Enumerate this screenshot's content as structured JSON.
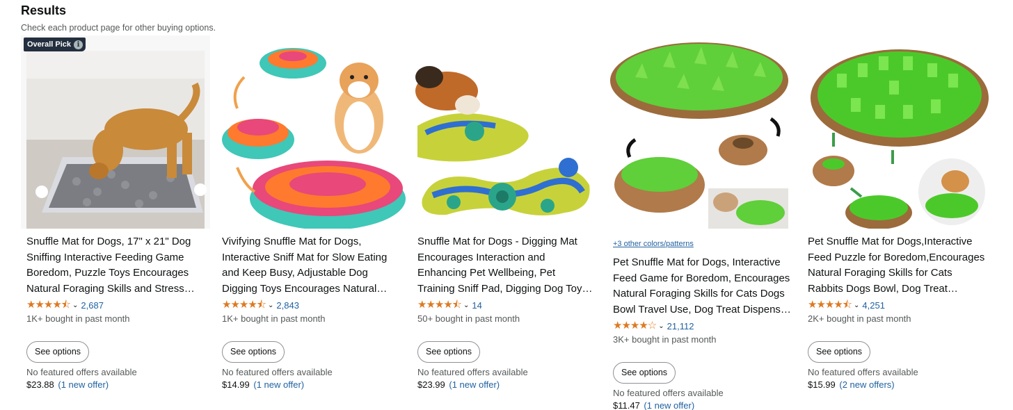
{
  "header": {
    "title": "Results",
    "subtitle": "Check each product page for other buying options."
  },
  "colors": {
    "star": "#de7921",
    "link": "#2162a1",
    "badge_bg": "#232f3e"
  },
  "products": [
    {
      "badge": "Overall Pick",
      "badge_icon": "info-icon",
      "title_lines": [
        "Snuffle Mat for Dogs, 17\" x 21\" Dog",
        "Sniffing Interactive Feeding Game",
        "Boredom, Puzzle Toys Encourages",
        "Natural Foraging Skills and Stress…"
      ],
      "stars": "★★★★⯪",
      "rating": 4.5,
      "rating_count": "2,687",
      "bought": "1K+ bought in past month",
      "button": "See options",
      "no_offer": "No featured offers available",
      "price": "$23.88",
      "offer": "(1 new offer)"
    },
    {
      "title_lines": [
        "Vivifying Snuffle Mat for Dogs,",
        "Interactive Sniff Mat for Slow Eating",
        "and Keep Busy, Adjustable Dog",
        "Digging Toys Encourages Natural…"
      ],
      "stars": "★★★★⯪",
      "rating": 4.5,
      "rating_count": "2,843",
      "bought": "1K+ bought in past month",
      "button": "See options",
      "no_offer": "No featured offers available",
      "price": "$14.99",
      "offer": "(1 new offer)"
    },
    {
      "title_lines": [
        "Snuffle Mat for Dogs - Digging Mat",
        "Encourages Interaction and",
        "Enhancing Pet Wellbeing, Pet",
        "Training Sniff Pad, Digging Dog Toy…"
      ],
      "stars": "★★★★⯪",
      "rating": 4.5,
      "rating_count": "14",
      "bought": "50+ bought in past month",
      "button": "See options",
      "no_offer": "No featured offers available",
      "price": "$23.99",
      "offer": "(1 new offer)"
    },
    {
      "colors_link": "+3 other colors/patterns",
      "title_lines": [
        "Pet Snuffle Mat for Dogs, Interactive",
        "Feed Game for Boredom, Encourages",
        "Natural Foraging Skills for Cats Dogs",
        "Bowl Travel Use, Dog Treat Dispens…"
      ],
      "stars": "★★★★☆",
      "rating": 4.0,
      "rating_count": "21,112",
      "bought": "3K+ bought in past month",
      "button": "See options",
      "no_offer": "No featured offers available",
      "price": "$11.47",
      "offer": "(1 new offer)"
    },
    {
      "title_lines": [
        "Pet Snuffle Mat for Dogs,Interactive",
        "Feed Puzzle for Boredom,Encourages",
        "Natural Foraging Skills for Cats",
        "Rabbits Dogs Bowl, Dog Treat…"
      ],
      "stars": "★★★★⯪",
      "rating": 4.5,
      "rating_count": "4,251",
      "bought": "2K+ bought in past month",
      "button": "See options",
      "no_offer": "No featured offers available",
      "price": "$15.99",
      "offer": "(2 new offers)"
    }
  ]
}
